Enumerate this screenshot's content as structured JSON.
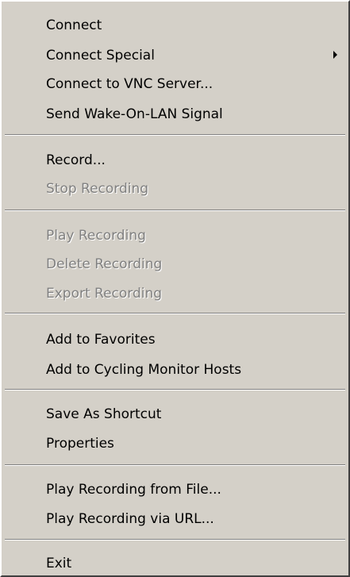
{
  "menu": {
    "items": [
      {
        "label": "Connect",
        "enabled": true
      },
      {
        "label": "Connect Special",
        "enabled": true,
        "submenu": true
      },
      {
        "label": "Connect to VNC Server...",
        "enabled": true
      },
      {
        "label": "Send Wake-On-LAN Signal",
        "enabled": true
      },
      {
        "label": "Record...",
        "enabled": true
      },
      {
        "label": "Stop Recording",
        "enabled": false
      },
      {
        "label": "Play Recording",
        "enabled": false
      },
      {
        "label": "Delete Recording",
        "enabled": false
      },
      {
        "label": "Export Recording",
        "enabled": false
      },
      {
        "label": "Add to Favorites",
        "enabled": true
      },
      {
        "label": "Add to Cycling Monitor Hosts",
        "enabled": true
      },
      {
        "label": "Save As Shortcut",
        "enabled": true
      },
      {
        "label": "Properties",
        "enabled": true
      },
      {
        "label": "Play Recording from File...",
        "enabled": true
      },
      {
        "label": "Play Recording via URL...",
        "enabled": true
      },
      {
        "label": "Exit",
        "enabled": true
      }
    ]
  },
  "colors": {
    "menu_bg": "#d4d0c8",
    "text": "#000000",
    "disabled_text": "#808080"
  }
}
